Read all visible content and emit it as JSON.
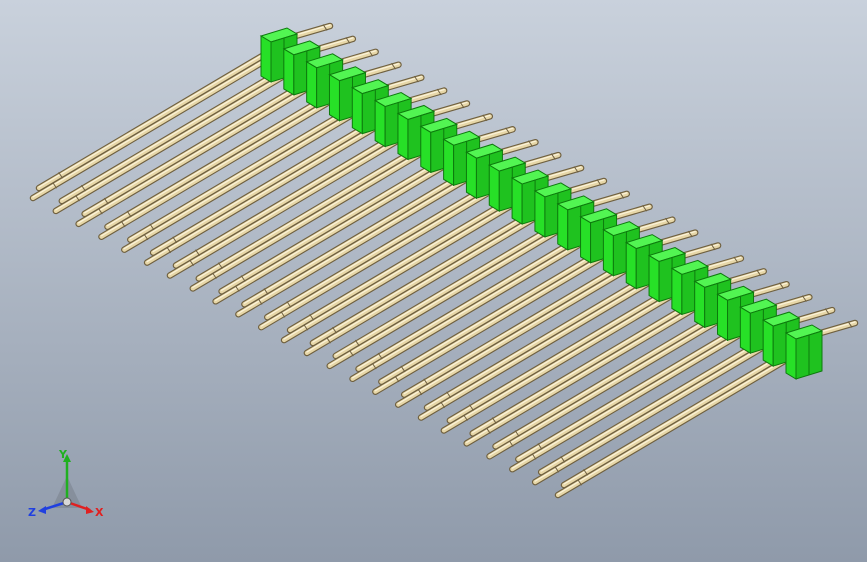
{
  "model": {
    "part": "pin-header",
    "pin_count": 24,
    "body_color": "#27e027",
    "body_edge_color": "#0d7a0d",
    "pin_color": "#e7d7a8",
    "pin_edge_color": "#6f6040"
  },
  "viewport": {
    "background_top": "#c9d1dc",
    "background_bottom": "#8f9aaa"
  },
  "triad": {
    "x_label": "X",
    "y_label": "Y",
    "z_label": "Z",
    "x_color": "#e02020",
    "y_color": "#20b020",
    "z_color": "#2040e0"
  }
}
